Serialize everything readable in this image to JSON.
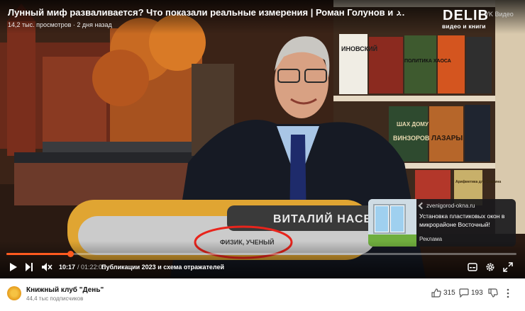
{
  "video": {
    "title": "Лунный миф разваливается? Что показали реальные измерения | Роман Голунов и Виталий Насенник",
    "meta": "14,2 тыс. просмотров · 2 дня назад",
    "brand": "DELIB",
    "brand_sub": "видео и книги",
    "vk_label": "VK Видео",
    "lower_third_name": "ВИТАЛИЙ НАСЕНН",
    "lower_third_role": "ФИЗИК, УЧЕНЫЙ",
    "book_spines": [
      "ИНОВСКИЙ",
      "ПОЛИТИКА ХАОСА",
      "ВИНЗОРОВ",
      "ЛАЗАРЫ",
      "Арифметика для Сталина",
      "ШАХ ДОМУ"
    ]
  },
  "ad": {
    "source": "zvenigorod-okna.ru",
    "text": "Установка пластиковых окон в микрорайоне Восточный!",
    "label": "Реклама"
  },
  "player": {
    "current_time": "10:17",
    "total_time": "/ 01:22:05",
    "chapter": "Публикации 2023 и схема отражателей",
    "progress": 0.125
  },
  "channel": {
    "name": "Книжный клуб \"День\"",
    "subscribers": "44,4 тыс подписчиков",
    "likes": "315",
    "comments": "193"
  },
  "colors": {
    "accent": "#ff5a1f",
    "annotation": "#e8241c"
  }
}
